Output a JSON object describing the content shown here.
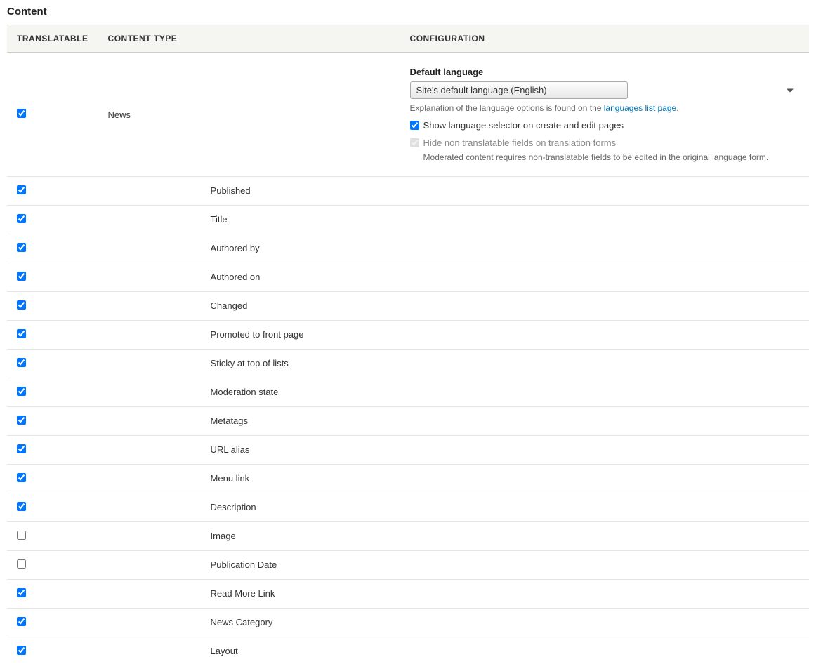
{
  "sectionTitle": "Content",
  "headers": {
    "translatable": "TRANSLATABLE",
    "contentType": "CONTENT TYPE",
    "configuration": "CONFIGURATION"
  },
  "mainRow": {
    "checked": true,
    "contentType": "News",
    "config": {
      "defaultLanguageLabel": "Default language",
      "defaultLanguageValue": "Site's default language (English)",
      "explanationPrefix": "Explanation of the language options is found on the ",
      "explanationLink": "languages list page",
      "explanationSuffix": ".",
      "showSelector": {
        "checked": true,
        "label": "Show language selector on create and edit pages"
      },
      "hideFields": {
        "checked": true,
        "disabled": true,
        "label": "Hide non translatable fields on translation forms",
        "note": "Moderated content requires non-translatable fields to be edited in the original language form."
      }
    }
  },
  "fieldRows": [
    {
      "checked": true,
      "label": "Published"
    },
    {
      "checked": true,
      "label": "Title"
    },
    {
      "checked": true,
      "label": "Authored by"
    },
    {
      "checked": true,
      "label": "Authored on"
    },
    {
      "checked": true,
      "label": "Changed"
    },
    {
      "checked": true,
      "label": "Promoted to front page"
    },
    {
      "checked": true,
      "label": "Sticky at top of lists"
    },
    {
      "checked": true,
      "label": "Moderation state"
    },
    {
      "checked": true,
      "label": "Metatags"
    },
    {
      "checked": true,
      "label": "URL alias"
    },
    {
      "checked": true,
      "label": "Menu link"
    },
    {
      "checked": true,
      "label": "Description"
    },
    {
      "checked": false,
      "label": "Image"
    },
    {
      "checked": false,
      "label": "Publication Date"
    },
    {
      "checked": true,
      "label": "Read More Link"
    },
    {
      "checked": true,
      "label": "News Category"
    },
    {
      "checked": true,
      "label": "Layout"
    }
  ]
}
